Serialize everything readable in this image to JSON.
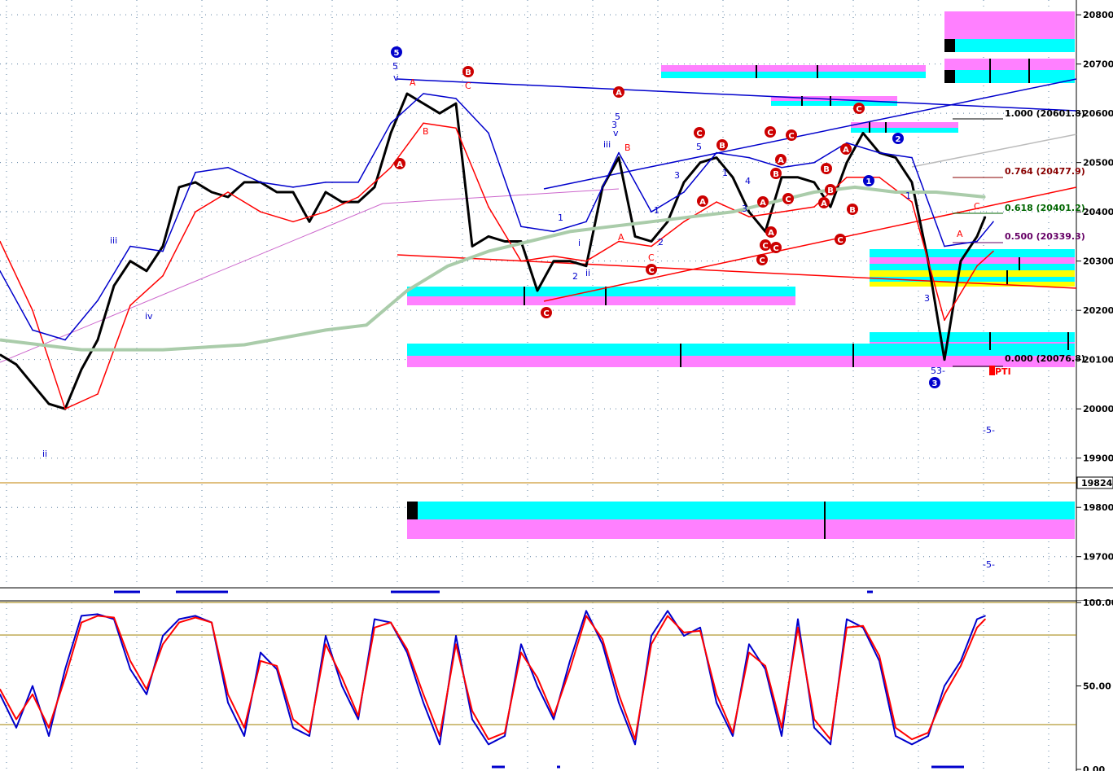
{
  "chart_data": [
    {
      "type": "line",
      "panel": "price",
      "ylim": [
        19640,
        20830
      ],
      "y_axis_ticks": [
        "20800",
        "20700",
        "20600",
        "20500",
        "20400",
        "20300",
        "20200",
        "20100",
        "20000",
        "19900",
        "19800",
        "19700"
      ],
      "current_price_label": "19824.",
      "grid": true,
      "series": [
        {
          "color": "#000000",
          "x": [
            0,
            20,
            40,
            60,
            80,
            100,
            120,
            140,
            160,
            180,
            200,
            220,
            240,
            260,
            280,
            300,
            320,
            340,
            360,
            380,
            400,
            420,
            440,
            460,
            480,
            500,
            520,
            540,
            560,
            580,
            600,
            620,
            640,
            660,
            680,
            700,
            720,
            740,
            760,
            780,
            800,
            820,
            840,
            860,
            880,
            900,
            920,
            940,
            960,
            980,
            1000,
            1020,
            1040,
            1060,
            1080,
            1100,
            1120,
            1140,
            1160,
            1180,
            1200,
            1210
          ],
          "values": [
            20110,
            20090,
            20050,
            20010,
            20000,
            20080,
            20140,
            20250,
            20300,
            20280,
            20330,
            20450,
            20460,
            20440,
            20430,
            20460,
            20460,
            20440,
            20440,
            20380,
            20440,
            20420,
            20420,
            20450,
            20560,
            20640,
            20620,
            20600,
            20620,
            20330,
            20350,
            20340,
            20340,
            20240,
            20300,
            20300,
            20290,
            20450,
            20510,
            20350,
            20340,
            20380,
            20460,
            20500,
            20510,
            20470,
            20400,
            20360,
            20470,
            20470,
            20460,
            20410,
            20500,
            20560,
            20520,
            20510,
            20460,
            20300,
            20100,
            20300,
            20350,
            20390
          ]
        },
        {
          "color": "#ff0000",
          "x": [
            0,
            40,
            80,
            120,
            160,
            200,
            240,
            280,
            320,
            360,
            400,
            440,
            480,
            520,
            560,
            600,
            640,
            680,
            720,
            760,
            800,
            840,
            880,
            920,
            960,
            1000,
            1040,
            1080,
            1120,
            1160,
            1200,
            1220
          ],
          "values": [
            20340,
            20200,
            20000,
            20030,
            20210,
            20270,
            20400,
            20440,
            20400,
            20380,
            20400,
            20430,
            20490,
            20580,
            20570,
            20410,
            20300,
            20310,
            20300,
            20340,
            20330,
            20380,
            20420,
            20390,
            20400,
            20410,
            20470,
            20470,
            20420,
            20180,
            20290,
            20320
          ]
        },
        {
          "color": "#0000cc",
          "x": [
            0,
            40,
            80,
            120,
            160,
            200,
            240,
            280,
            320,
            360,
            400,
            440,
            480,
            520,
            560,
            600,
            640,
            680,
            720,
            760,
            800,
            840,
            880,
            920,
            960,
            1000,
            1040,
            1080,
            1120,
            1160,
            1200,
            1220
          ],
          "values": [
            20280,
            20160,
            20140,
            20220,
            20330,
            20320,
            20480,
            20490,
            20460,
            20450,
            20460,
            20460,
            20580,
            20640,
            20630,
            20560,
            20370,
            20360,
            20380,
            20520,
            20400,
            20440,
            20520,
            20510,
            20490,
            20500,
            20540,
            20520,
            20510,
            20330,
            20340,
            20380
          ]
        },
        {
          "color": "#aaccaa",
          "x": [
            0,
            100,
            200,
            300,
            400,
            450,
            500,
            550,
            600,
            650,
            700,
            750,
            800,
            850,
            900,
            950,
            1000,
            1050,
            1100,
            1150,
            1210
          ],
          "values": [
            20140,
            20120,
            20120,
            20130,
            20160,
            20170,
            20240,
            20290,
            20320,
            20340,
            20360,
            20370,
            20380,
            20390,
            20400,
            20420,
            20440,
            20450,
            20440,
            20440,
            20430
          ]
        }
      ]
    },
    {
      "type": "line",
      "panel": "oscillator",
      "ylim": [
        0,
        100
      ],
      "y_axis_ticks": [
        "100.00",
        "50.00",
        "0.00"
      ],
      "grid": true,
      "series": [
        {
          "color": "#0000cc",
          "x": [
            0,
            20,
            40,
            60,
            80,
            100,
            120,
            140,
            160,
            180,
            200,
            220,
            240,
            260,
            280,
            300,
            320,
            340,
            360,
            380,
            400,
            420,
            440,
            460,
            480,
            500,
            520,
            540,
            560,
            580,
            600,
            620,
            640,
            660,
            680,
            700,
            720,
            740,
            760,
            780,
            800,
            820,
            840,
            860,
            880,
            900,
            920,
            940,
            960,
            980,
            1000,
            1020,
            1040,
            1060,
            1080,
            1100,
            1120,
            1140,
            1160,
            1180,
            1200,
            1210
          ],
          "values": [
            45,
            25,
            50,
            20,
            60,
            92,
            93,
            90,
            60,
            45,
            80,
            90,
            92,
            88,
            40,
            20,
            70,
            60,
            25,
            20,
            80,
            50,
            30,
            90,
            88,
            70,
            40,
            15,
            80,
            30,
            15,
            20,
            75,
            50,
            30,
            65,
            95,
            75,
            40,
            15,
            80,
            95,
            80,
            85,
            40,
            20,
            75,
            60,
            20,
            90,
            25,
            15,
            90,
            85,
            65,
            20,
            15,
            20,
            50,
            65,
            90,
            92
          ]
        },
        {
          "color": "#ff0000",
          "x": [
            0,
            20,
            40,
            60,
            80,
            100,
            120,
            140,
            160,
            180,
            200,
            220,
            240,
            260,
            280,
            300,
            320,
            340,
            360,
            380,
            400,
            420,
            440,
            460,
            480,
            500,
            520,
            540,
            560,
            580,
            600,
            620,
            640,
            660,
            680,
            700,
            720,
            740,
            760,
            780,
            800,
            820,
            840,
            860,
            880,
            900,
            920,
            940,
            960,
            980,
            1000,
            1020,
            1040,
            1060,
            1080,
            1100,
            1120,
            1140,
            1160,
            1180,
            1200,
            1210
          ],
          "values": [
            48,
            30,
            45,
            25,
            55,
            88,
            92,
            91,
            65,
            48,
            75,
            88,
            91,
            88,
            45,
            25,
            65,
            62,
            30,
            22,
            75,
            55,
            32,
            85,
            88,
            72,
            45,
            20,
            75,
            35,
            18,
            22,
            70,
            55,
            32,
            60,
            92,
            78,
            45,
            18,
            75,
            92,
            82,
            83,
            45,
            22,
            70,
            62,
            25,
            85,
            30,
            18,
            85,
            86,
            68,
            25,
            18,
            22,
            45,
            62,
            85,
            90
          ]
        }
      ]
    }
  ],
  "annotations": {
    "fib_levels": [
      {
        "label": "1.000 (20601.8)",
        "color": "#000000"
      },
      {
        "label": "0.764 (20477.9)",
        "color": "#880000"
      },
      {
        "label": "0.618 (20401.2)",
        "color": "#006600"
      },
      {
        "label": "0.500 (20339.3)",
        "color": "#660066"
      },
      {
        "label": "0.000 (20076.8)",
        "color": "#000000"
      }
    ],
    "pti_label": "PTI",
    "minus_five_top": "-5-",
    "minus_five_bottom": "-5-",
    "blue_wave_labels": [
      "5",
      "5",
      "v",
      "5",
      "3",
      "v",
      "iii",
      "iii",
      "iv",
      "ii",
      "i",
      "ii",
      "1",
      "2",
      "2",
      "1",
      "3",
      "5",
      "1",
      "3",
      "4",
      "1",
      "2",
      "3",
      "4",
      "5",
      "53-",
      "1",
      "3"
    ],
    "red_wave_labels": [
      "A",
      "B",
      "C",
      "A",
      "B",
      "C",
      "B",
      "C",
      "A",
      "B"
    ],
    "red_circles": [
      "B",
      "A",
      "A",
      "C",
      "C",
      "B",
      "A",
      "C",
      "A",
      "C",
      "C",
      "A",
      "B",
      "A",
      "C",
      "A",
      "C",
      "C",
      "A",
      "C",
      "B",
      "B",
      "A",
      "B",
      "A",
      "C",
      "C",
      "A",
      "B",
      "A",
      "B",
      "C",
      "C"
    ],
    "blue_circles": [
      "5",
      "1",
      "2",
      "3"
    ],
    "colors": {
      "cyan": "#00ffff",
      "magenta": "#ff80ff",
      "blue": "#0000cc",
      "red": "#ff0000",
      "olive_grid": "#a08000"
    }
  }
}
